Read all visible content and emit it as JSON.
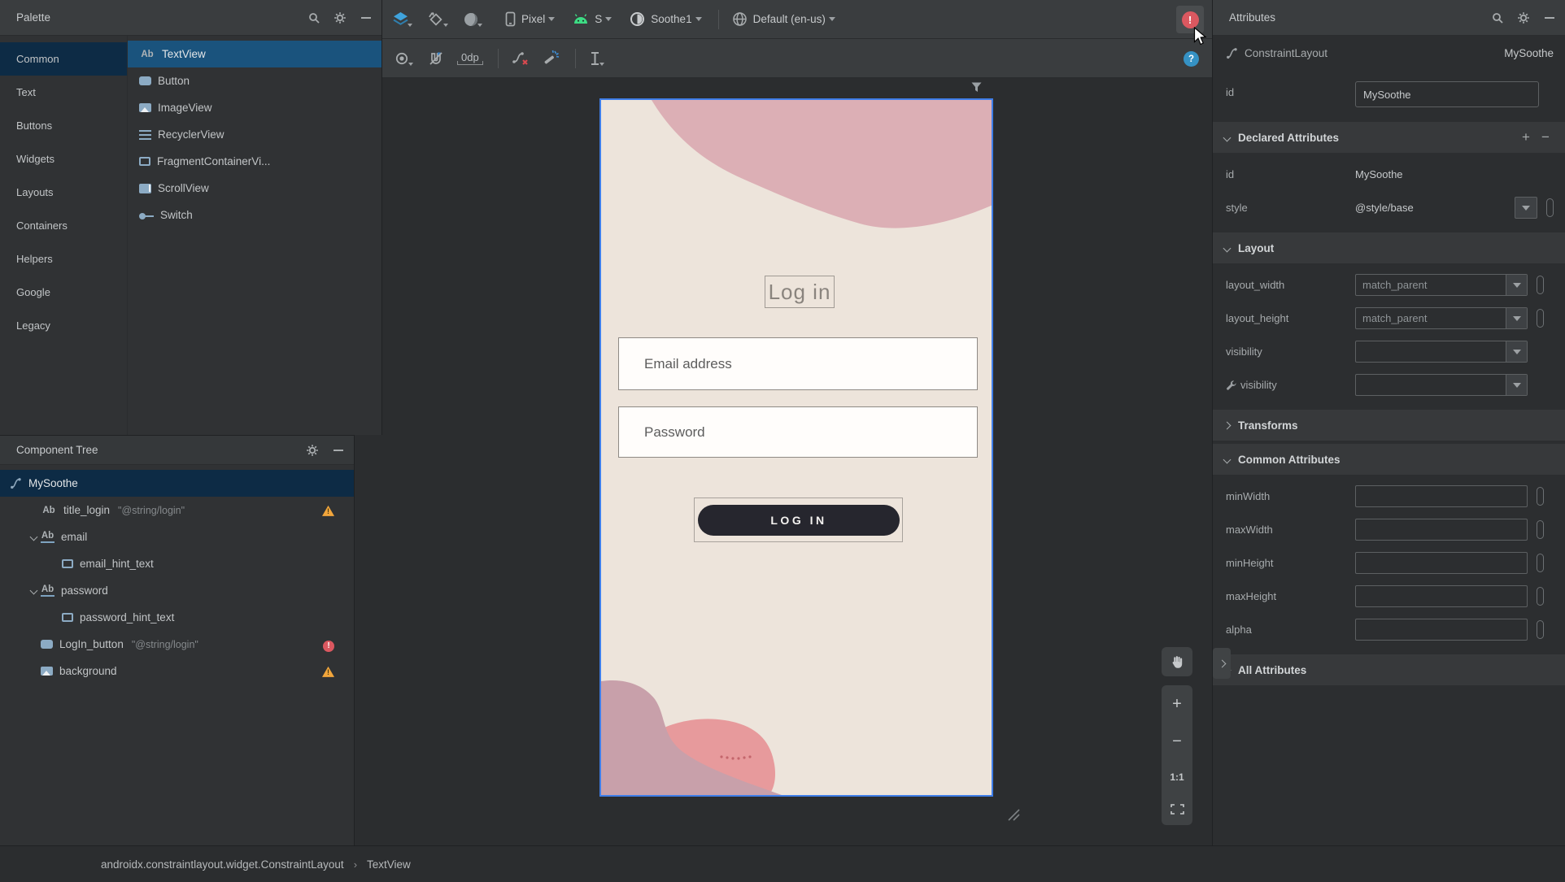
{
  "colors": {
    "accent_blue": "#3f7ee8",
    "selection_navy": "#0d2b45",
    "selection_blue": "#1a537d",
    "error_red": "#db5860",
    "warning_yellow": "#f2a63c",
    "android_green": "#3ddc84",
    "screen_cream": "#ede4db",
    "blob_pink": "#dcafb5",
    "blob_mauve": "#c8a0aa",
    "blob_salmon": "#e79a9c",
    "login_button_bg": "#26262e"
  },
  "palette": {
    "title": "Palette",
    "categories": [
      {
        "label": "Common",
        "selected": true
      },
      {
        "label": "Text"
      },
      {
        "label": "Buttons"
      },
      {
        "label": "Widgets"
      },
      {
        "label": "Layouts"
      },
      {
        "label": "Containers"
      },
      {
        "label": "Helpers"
      },
      {
        "label": "Google"
      },
      {
        "label": "Legacy"
      }
    ],
    "items": [
      {
        "icon": "textview-icon",
        "label": "TextView",
        "selected": true
      },
      {
        "icon": "button-icon",
        "label": "Button"
      },
      {
        "icon": "imageview-icon",
        "label": "ImageView"
      },
      {
        "icon": "recyclerview-icon",
        "label": "RecyclerView"
      },
      {
        "icon": "fragment-icon",
        "label": "FragmentContainerVi..."
      },
      {
        "icon": "scrollview-icon",
        "label": "ScrollView"
      },
      {
        "icon": "switch-icon",
        "label": "Switch"
      }
    ]
  },
  "design_toolbar": {
    "device_label": "Pixel",
    "api_label": "S",
    "theme_label": "Soothe1",
    "locale_label": "Default (en-us)",
    "default_margin": "0dp"
  },
  "component_tree": {
    "title": "Component Tree",
    "items": [
      {
        "icon": "constraint-icon",
        "label": "MySoothe",
        "depth": 0,
        "selected": true
      },
      {
        "icon": "textview-icon",
        "label": "title_login",
        "value": "\"@string/login\"",
        "depth": 1,
        "badge": "warning-badge"
      },
      {
        "icon": "textview-underline-icon",
        "label": "email",
        "depth": 1,
        "expanded": true
      },
      {
        "icon": "frame-icon",
        "label": "email_hint_text",
        "depth": 2
      },
      {
        "icon": "textview-underline-icon",
        "label": "password",
        "depth": 1,
        "expanded": true
      },
      {
        "icon": "frame-icon",
        "label": "password_hint_text",
        "depth": 2
      },
      {
        "icon": "button-icon",
        "label": "LogIn_button",
        "value": "\"@string/login\"",
        "depth": 1,
        "badge": "error-badge"
      },
      {
        "icon": "imageview-icon",
        "label": "background",
        "depth": 1,
        "badge": "warning-badge"
      }
    ]
  },
  "canvas": {
    "screen_title": "Log in",
    "email_placeholder": "Email address",
    "password_placeholder": "Password",
    "login_button_label": "LOG IN",
    "zoom_one_to_one": "1:1"
  },
  "attributes": {
    "title": "Attributes",
    "component_type": "ConstraintLayout",
    "component_id": "MySoothe",
    "id_label": "id",
    "id_value": "MySoothe",
    "sections": [
      {
        "name": "Declared Attributes",
        "expanded": true,
        "has_actions": true,
        "rows": [
          {
            "label": "id",
            "value": "MySoothe",
            "control": "text"
          },
          {
            "label": "style",
            "value": "@style/base",
            "control": "dropdown-flag"
          }
        ]
      },
      {
        "name": "Layout",
        "expanded": true,
        "rows": [
          {
            "label": "layout_width",
            "value": "match_parent",
            "control": "combo-flag"
          },
          {
            "label": "layout_height",
            "value": "match_parent",
            "control": "combo-flag"
          },
          {
            "label": "visibility",
            "value": "",
            "control": "combo"
          },
          {
            "label": "visibility",
            "value": "",
            "control": "combo",
            "wrench": true
          }
        ]
      },
      {
        "name": "Transforms",
        "expanded": false,
        "rows": []
      },
      {
        "name": "Common Attributes",
        "expanded": true,
        "rows": [
          {
            "label": "minWidth",
            "value": "",
            "control": "input-flag"
          },
          {
            "label": "maxWidth",
            "value": "",
            "control": "input-flag"
          },
          {
            "label": "minHeight",
            "value": "",
            "control": "input-flag"
          },
          {
            "label": "maxHeight",
            "value": "",
            "control": "input-flag"
          },
          {
            "label": "alpha",
            "value": "",
            "control": "input-flag"
          }
        ]
      },
      {
        "name": "All Attributes",
        "expanded": false,
        "rows": []
      }
    ]
  },
  "status_bar": {
    "breadcrumbs": [
      "androidx.constraintlayout.widget.ConstraintLayout",
      "TextView"
    ],
    "separator": "›"
  }
}
